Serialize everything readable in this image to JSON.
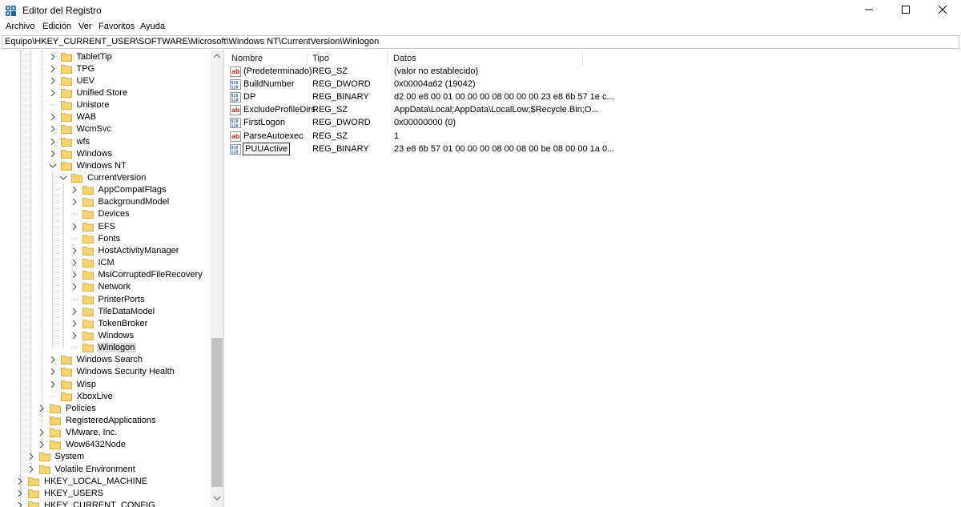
{
  "window": {
    "title": "Editor del Registro",
    "icon": "regedit-icon",
    "controls": {
      "minimize": "minimize-icon",
      "maximize": "maximize-icon",
      "close": "close-icon"
    }
  },
  "menu": [
    "Archivo",
    "Edición",
    "Ver",
    "Favoritos",
    "Ayuda"
  ],
  "address": "Equipo\\HKEY_CURRENT_USER\\SOFTWARE\\Microsoft\\Windows NT\\CurrentVersion\\Winlogon",
  "tree": [
    {
      "label": "TabletTip",
      "level": 3,
      "expander": "collapsed"
    },
    {
      "label": "TPG",
      "level": 3,
      "expander": "collapsed"
    },
    {
      "label": "UEV",
      "level": 3,
      "expander": "collapsed"
    },
    {
      "label": "Unified Store",
      "level": 3,
      "expander": "collapsed"
    },
    {
      "label": "Unistore",
      "level": 3,
      "expander": "none"
    },
    {
      "label": "WAB",
      "level": 3,
      "expander": "collapsed"
    },
    {
      "label": "WcmSvc",
      "level": 3,
      "expander": "collapsed"
    },
    {
      "label": "wfs",
      "level": 3,
      "expander": "collapsed"
    },
    {
      "label": "Windows",
      "level": 3,
      "expander": "collapsed"
    },
    {
      "label": "Windows NT",
      "level": 3,
      "expander": "expanded"
    },
    {
      "label": "CurrentVersion",
      "level": 4,
      "expander": "expanded"
    },
    {
      "label": "AppCompatFlags",
      "level": 5,
      "expander": "collapsed"
    },
    {
      "label": "BackgroundModel",
      "level": 5,
      "expander": "collapsed"
    },
    {
      "label": "Devices",
      "level": 5,
      "expander": "none"
    },
    {
      "label": "EFS",
      "level": 5,
      "expander": "collapsed"
    },
    {
      "label": "Fonts",
      "level": 5,
      "expander": "none"
    },
    {
      "label": "HostActivityManager",
      "level": 5,
      "expander": "collapsed"
    },
    {
      "label": "ICM",
      "level": 5,
      "expander": "collapsed"
    },
    {
      "label": "MsiCorruptedFileRecovery",
      "level": 5,
      "expander": "collapsed"
    },
    {
      "label": "Network",
      "level": 5,
      "expander": "collapsed"
    },
    {
      "label": "PrinterPorts",
      "level": 5,
      "expander": "none"
    },
    {
      "label": "TileDataModel",
      "level": 5,
      "expander": "collapsed"
    },
    {
      "label": "TokenBroker",
      "level": 5,
      "expander": "collapsed"
    },
    {
      "label": "Windows",
      "level": 5,
      "expander": "collapsed"
    },
    {
      "label": "Winlogon",
      "level": 5,
      "expander": "none",
      "selected": true
    },
    {
      "label": "Windows Search",
      "level": 3,
      "expander": "collapsed"
    },
    {
      "label": "Windows Security Health",
      "level": 3,
      "expander": "collapsed"
    },
    {
      "label": "Wisp",
      "level": 3,
      "expander": "collapsed"
    },
    {
      "label": "XboxLive",
      "level": 3,
      "expander": "none"
    },
    {
      "label": "Policies",
      "level": 2,
      "expander": "collapsed"
    },
    {
      "label": "RegisteredApplications",
      "level": 2,
      "expander": "none"
    },
    {
      "label": "VMware, Inc.",
      "level": 2,
      "expander": "collapsed"
    },
    {
      "label": "Wow6432Node",
      "level": 2,
      "expander": "collapsed"
    },
    {
      "label": "System",
      "level": 1,
      "expander": "collapsed"
    },
    {
      "label": "Volatile Environment",
      "level": 1,
      "expander": "collapsed"
    },
    {
      "label": "HKEY_LOCAL_MACHINE",
      "level": 0,
      "expander": "collapsed"
    },
    {
      "label": "HKEY_USERS",
      "level": 0,
      "expander": "collapsed"
    },
    {
      "label": "HKEY_CURRENT_CONFIG",
      "level": 0,
      "expander": "collapsed"
    }
  ],
  "columns": [
    "Nombre",
    "Tipo",
    "Datos"
  ],
  "values": [
    {
      "name": "(Predeterminado)",
      "type": "REG_SZ",
      "data": "(valor no establecido)",
      "icon": "string-value-icon"
    },
    {
      "name": "BuildNumber",
      "type": "REG_DWORD",
      "data": "0x00004a62 (19042)",
      "icon": "binary-value-icon"
    },
    {
      "name": "DP",
      "type": "REG_BINARY",
      "data": "d2 00 e8 00 01 00 00 00 08 00 00 00 23 e8 6b 57 1e c...",
      "icon": "binary-value-icon"
    },
    {
      "name": "ExcludeProfileDirs",
      "type": "REG_SZ",
      "data": "AppData\\Local;AppData\\LocalLow;$Recycle.Bin;O...",
      "icon": "string-value-icon"
    },
    {
      "name": "FirstLogon",
      "type": "REG_DWORD",
      "data": "0x00000000 (0)",
      "icon": "binary-value-icon"
    },
    {
      "name": "ParseAutoexec",
      "type": "REG_SZ",
      "data": "1",
      "icon": "string-value-icon"
    },
    {
      "name": "PUUActive",
      "type": "REG_BINARY",
      "data": "23 e8 6b 57 01 00 00 00 08 00 08 00 be 08 00 00 1a 0...",
      "icon": "binary-value-icon",
      "editing": true
    }
  ],
  "colors": {
    "folder": "#f3d573",
    "folder_edge": "#d8b243",
    "selection": "#d9d9d9",
    "string_icon": "#c0392b",
    "binary_icon": "#2b5fb3"
  }
}
